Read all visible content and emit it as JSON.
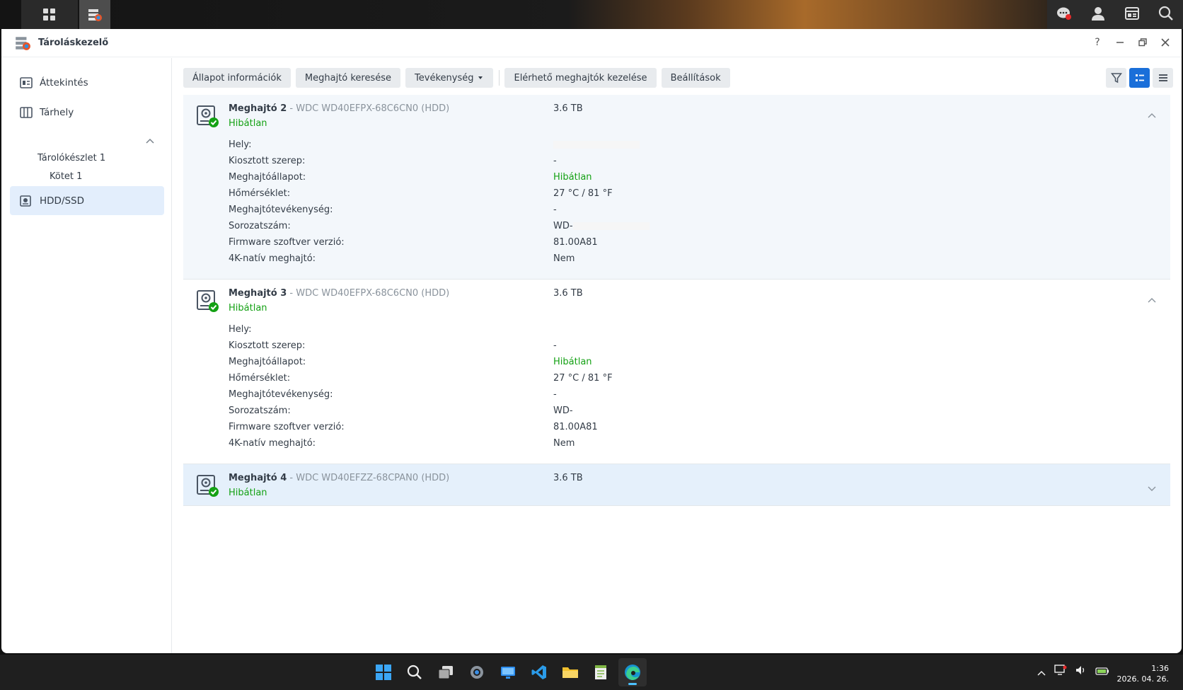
{
  "window": {
    "title": "Tároláskezelő"
  },
  "sidebar": {
    "items": [
      {
        "label": "Áttekintés"
      },
      {
        "label": "Tárhely"
      },
      {
        "label": "HDD/SSD"
      }
    ],
    "sub": {
      "pool": "Tárolókészlet 1",
      "volume": "Kötet 1"
    }
  },
  "toolbar": {
    "status_info": "Állapot információk",
    "find_drive": "Meghajtó keresése",
    "activity": "Tevékenység",
    "manage_available": "Elérhető meghajtók kezelése",
    "settings": "Beállítások"
  },
  "labels": {
    "location": "Hely:",
    "assigned_role": "Kiosztott szerep:",
    "drive_status": "Meghajtóállapot:",
    "temperature": "Hőmérséklet:",
    "drive_activity": "Meghajtótevékenység:",
    "serial": "Sorozatszám:",
    "firmware": "Firmware szoftver verzió:",
    "native_4k": "4K-natív meghajtó:"
  },
  "drives": [
    {
      "name": "Meghajtó 2",
      "model": " - WDC WD40EFPX-68C6CN0 (HDD)",
      "status": "Hibátlan",
      "size": "3.6 TB",
      "role": "-",
      "drive_status": "Hibátlan",
      "temperature": "27 °C / 81 °F",
      "activity": "-",
      "serial": "WD-",
      "firmware": "81.00A81",
      "native_4k": "Nem"
    },
    {
      "name": "Meghajtó 3",
      "model": " - WDC WD40EFPX-68C6CN0 (HDD)",
      "status": "Hibátlan",
      "size": "3.6 TB",
      "role": "-",
      "drive_status": "Hibátlan",
      "temperature": "27 °C / 81 °F",
      "activity": "-",
      "serial": "WD-",
      "firmware": "81.00A81",
      "native_4k": "Nem"
    },
    {
      "name": "Meghajtó 4",
      "model": " - WDC WD40EFZZ-68CPAN0 (HDD)",
      "status": "Hibátlan",
      "size": "3.6 TB"
    }
  ],
  "clock": {
    "time": "1:36",
    "date": "2026. 04. 26."
  },
  "colors": {
    "accent": "#1a6fd9",
    "healthy": "#14a114",
    "active_bg": "#e3eefc"
  }
}
